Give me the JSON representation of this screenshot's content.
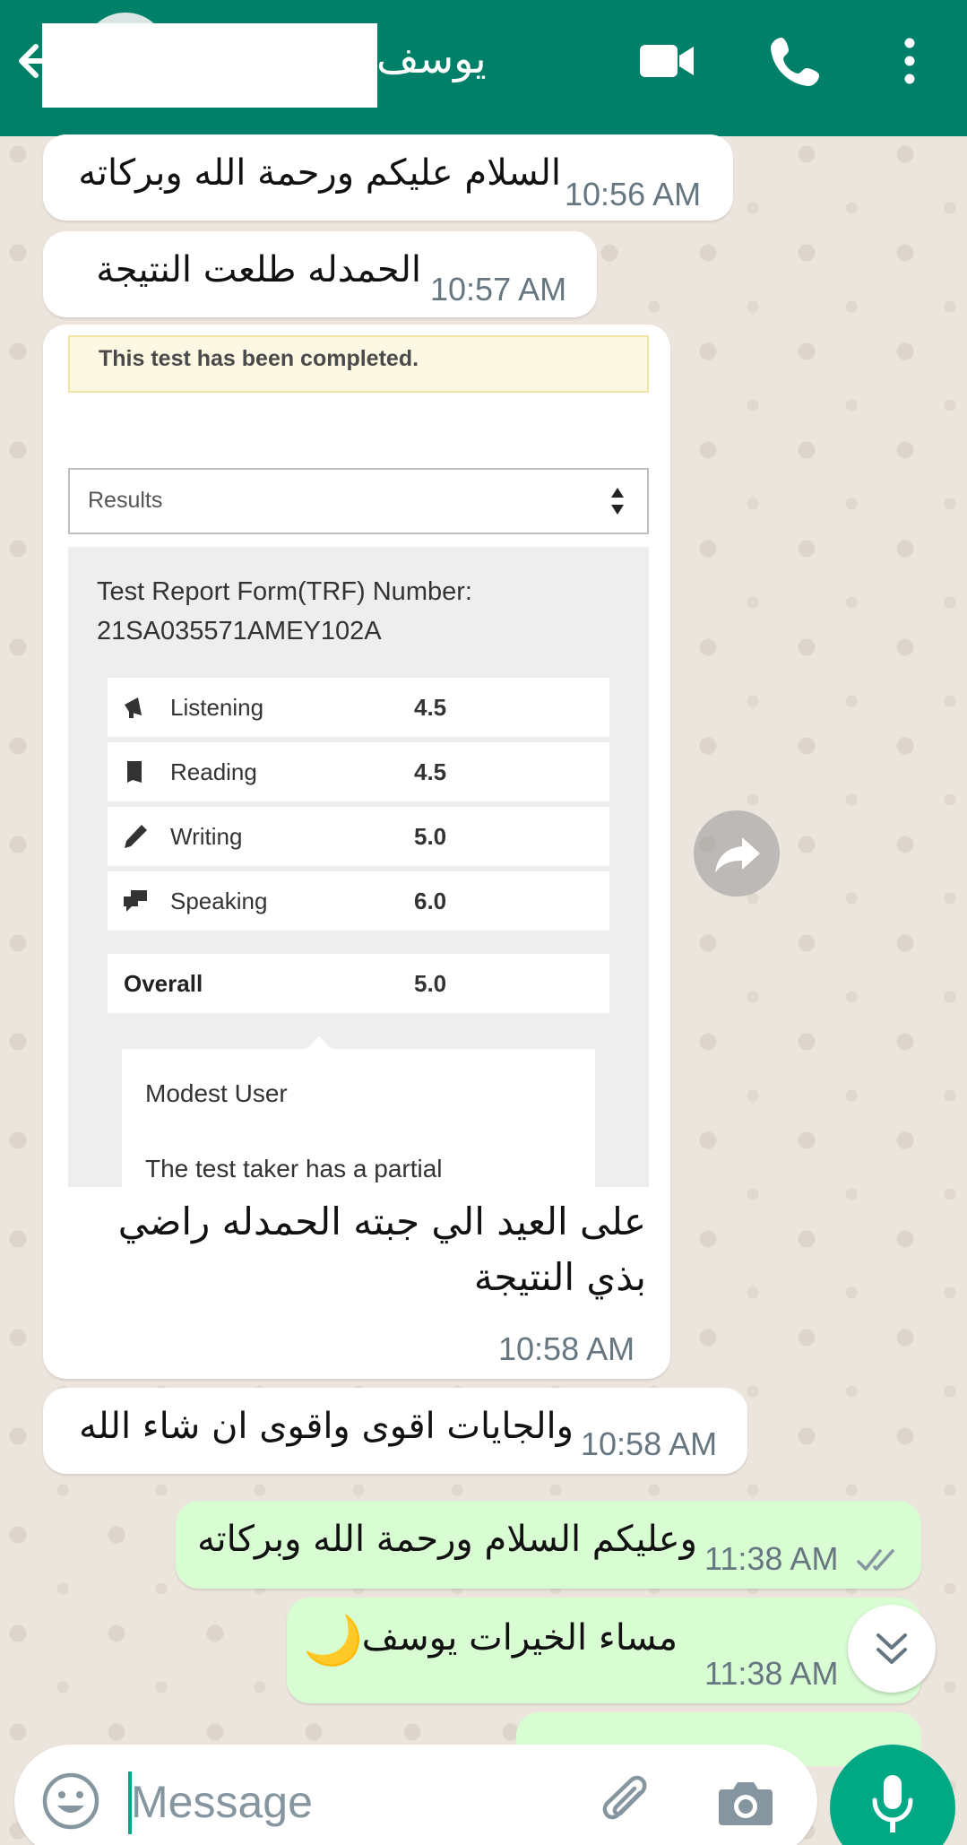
{
  "header": {
    "contact_name": "يوسف",
    "icons": [
      "back-arrow-icon",
      "avatar",
      "video-call-icon",
      "voice-call-icon",
      "more-options-icon"
    ]
  },
  "messages": [
    {
      "direction": "in",
      "text": "السلام عليكم ورحمة الله وبركاته",
      "time": "10:56 AM"
    },
    {
      "direction": "in",
      "text": "الحمدله طلعت النتيجة",
      "time": "10:57 AM"
    },
    {
      "direction": "in",
      "type": "image",
      "caption_line1": "على العيد الي جبته الحمدله راضي",
      "caption_line2": "بذي النتيجة",
      "time": "10:58 AM"
    },
    {
      "direction": "in",
      "text": "والجايات اقوى واقوى ان شاء الله",
      "time": "10:58 AM"
    },
    {
      "direction": "out",
      "text": "وعليكم السلام ورحمة الله وبركاته",
      "time": "11:38 AM",
      "status": "read"
    },
    {
      "direction": "out",
      "text": "مساء الخيرات يوسف",
      "emoji": "🌙",
      "time": "11:38 AM",
      "status": "read"
    }
  ],
  "result_image": {
    "alert": "This test has been completed.",
    "select_value": "Results",
    "trf_label": "Test Report Form(TRF) Number:",
    "trf_number": "21SA035571AMEY102A",
    "scores": [
      {
        "label": "Listening",
        "value": "4.5",
        "icon": "megaphone-icon"
      },
      {
        "label": "Reading",
        "value": "4.5",
        "icon": "book-icon"
      },
      {
        "label": "Writing",
        "value": "5.0",
        "icon": "pencil-icon"
      },
      {
        "label": "Speaking",
        "value": "6.0",
        "icon": "speech-bubbles-icon"
      }
    ],
    "overall_label": "Overall",
    "overall_value": "5.0",
    "band_title": "Modest User",
    "band_text": "The test taker has a partial"
  },
  "composer": {
    "placeholder": "Message"
  },
  "colors": {
    "header": "#008069",
    "outgoing_bubble": "#d9fdd3",
    "incoming_bubble": "#ffffff",
    "accent": "#00a884",
    "chat_background": "#ece5dd"
  }
}
